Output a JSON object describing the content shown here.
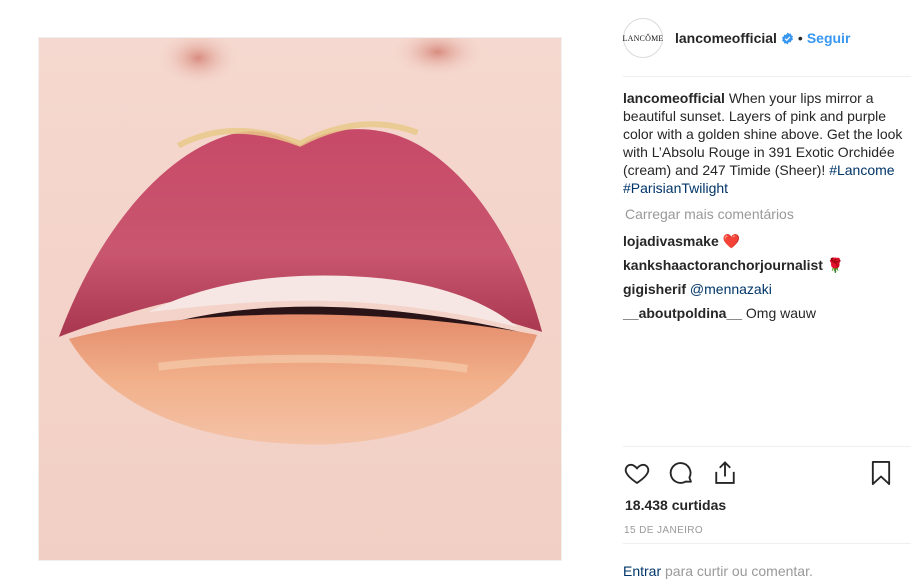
{
  "post": {
    "image_alt": "Close-up of lips with pink and peach lipstick and golden shine",
    "account": {
      "avatar_text": "LANCÔME",
      "username": "lancomeofficial",
      "verified": true,
      "separator": "•",
      "follow_label": "Seguir"
    },
    "caption": {
      "username": "lancomeofficial",
      "text": "When your lips mirror a beautiful sunset. Layers of pink and purple color with a golden shine above. Get the look with L’Absolu Rouge in 391 Exotic Orchidée (cream) and 247 Timide (Sheer)!",
      "hashtags": "#Lancome #ParisianTwilight"
    },
    "load_more_label": "Carregar mais comentários",
    "comments": [
      {
        "username": "lojadivasmake",
        "text": "❤️"
      },
      {
        "username": "kankshaactoranchorjournalist",
        "text": "🌹"
      },
      {
        "username": "gigisherif",
        "text": "@mennazaki"
      },
      {
        "username": "__aboutpoldina__",
        "text": "Omg wauw"
      }
    ],
    "likes_label": "18.438 curtidas",
    "date_label": "15 DE JANEIRO",
    "login_prompt": {
      "link": "Entrar",
      "text": " para curtir ou comentar."
    },
    "colors": {
      "link": "#3897f0",
      "hashtag": "#003569",
      "muted": "#999999",
      "heart": "#ed4956"
    },
    "icons": [
      "heart-icon",
      "comment-icon",
      "share-icon",
      "bookmark-icon",
      "verified-badge-icon"
    ]
  }
}
